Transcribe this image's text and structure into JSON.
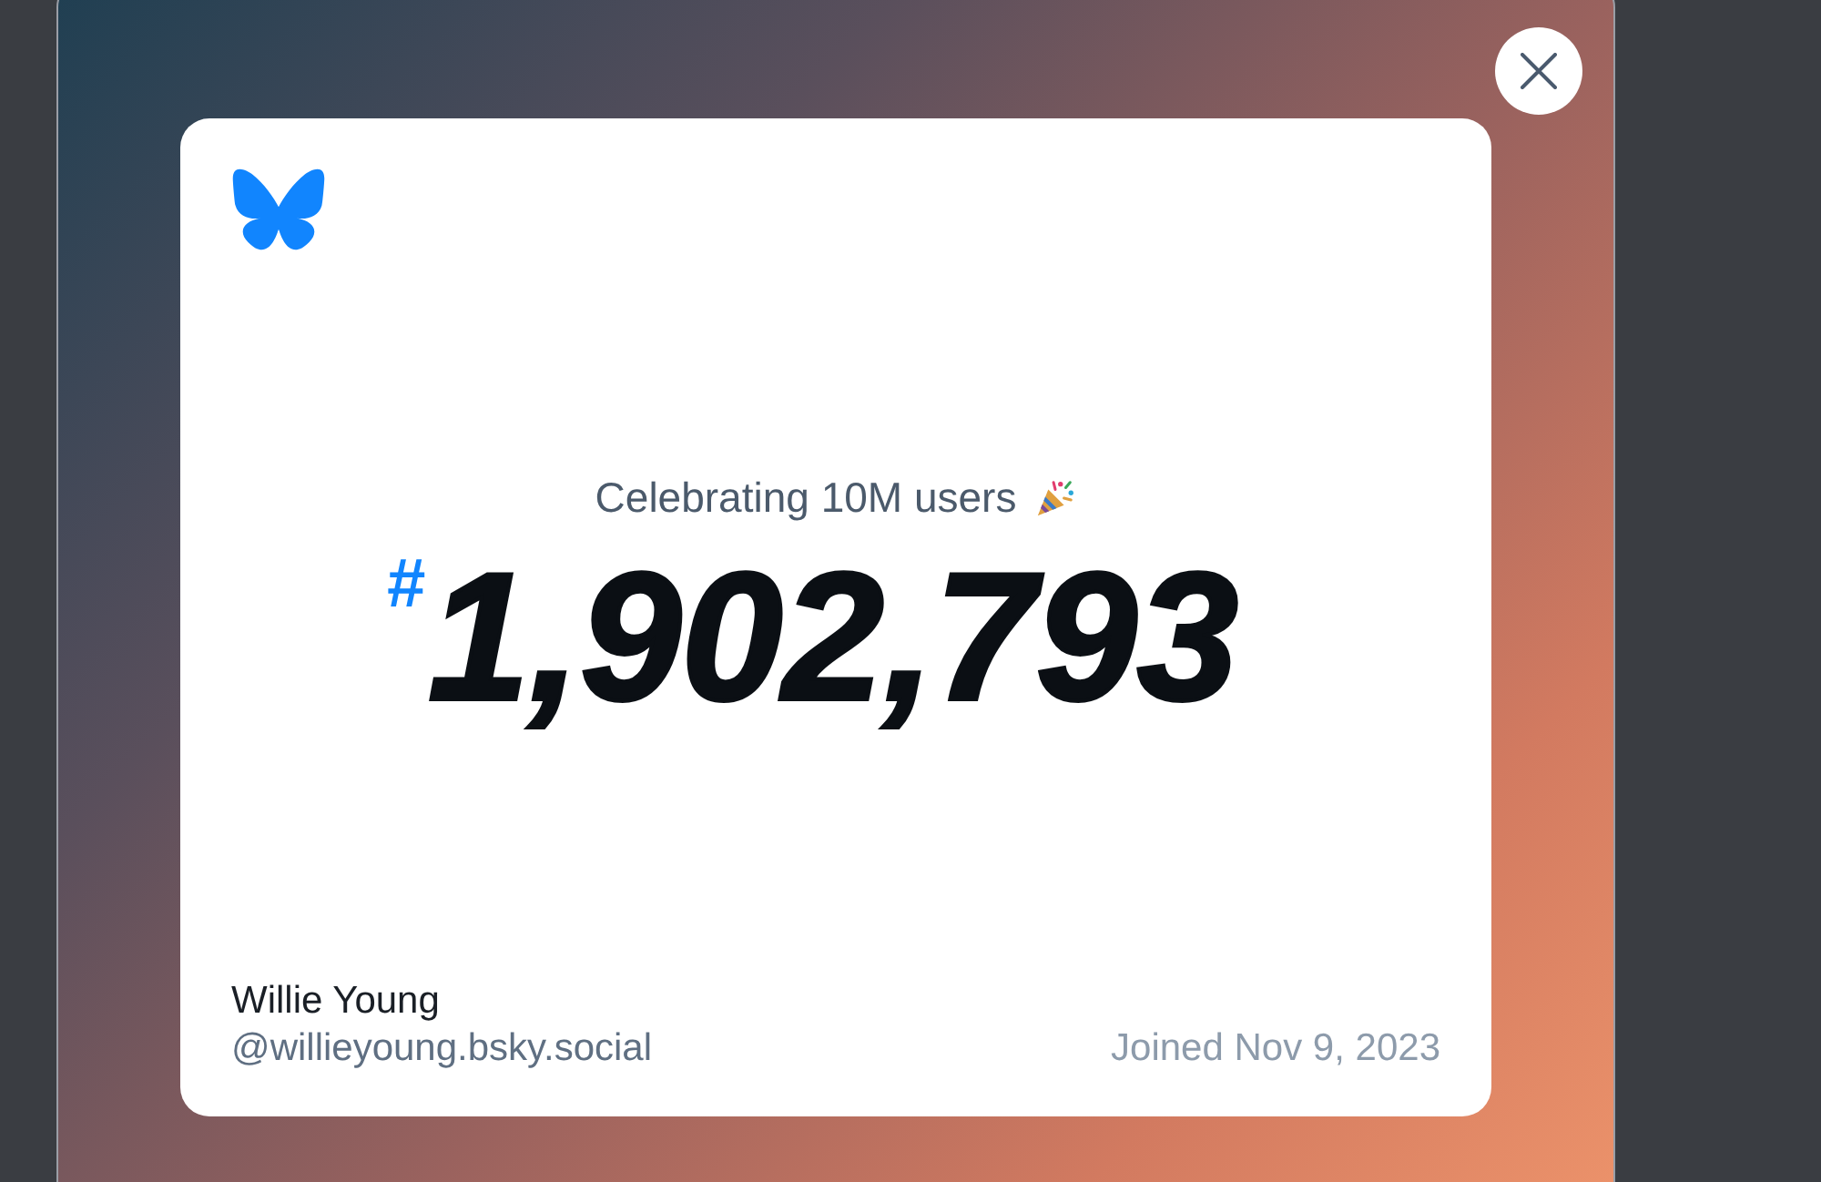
{
  "card": {
    "subtitle": "Celebrating 10M users",
    "user_number": {
      "prefix": "#",
      "value": "1,902,793"
    },
    "display_name": "Willie Young",
    "handle": "@willieyoung.bsky.social",
    "joined": "Joined Nov 9, 2023"
  }
}
